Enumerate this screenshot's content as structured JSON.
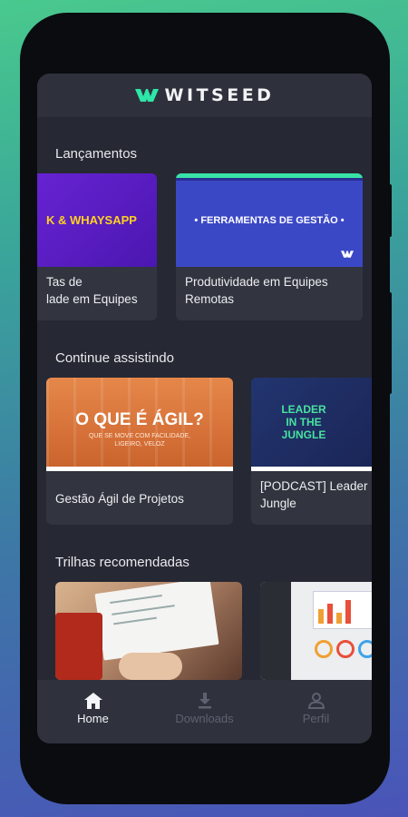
{
  "app": {
    "brand": "WITSEED",
    "brand_color": "#2ee6a8"
  },
  "sections": [
    {
      "title": "Lançamentos",
      "cards": [
        {
          "title": "Tas de\nlade em Equipes",
          "thumb_text": "K & WHAYSAPP",
          "thumb_color": "#5a1fc9"
        },
        {
          "title": "Produtividade em Equipes Remotas",
          "thumb_text": "• FERRAMENTAS DE GESTÃO •",
          "thumb_color": "#3a47c4"
        }
      ]
    },
    {
      "title": "Continue assistindo",
      "cards": [
        {
          "title": "Gestão Ágil de Projetos",
          "thumb_text": "O QUE É ÁGIL?",
          "thumb_subtext": "QUE SE MOVE COM FACILIDADE, LIGEIRO, VELOZ",
          "thumb_color": "#d9753a"
        },
        {
          "title": "[PODCAST] Leader Jungle",
          "thumb_text": "LEADER IN THE JUNGLE",
          "thumb_color": "#1d2e6b"
        }
      ]
    },
    {
      "title": "Trilhas recomendadas",
      "cards": [
        {
          "title": "",
          "thumb_color": "#c7a27e"
        },
        {
          "title": "",
          "thumb_color": "#e9eaee"
        }
      ]
    }
  ],
  "tabs": [
    {
      "label": "Home",
      "icon": "home-icon",
      "active": true
    },
    {
      "label": "Downloads",
      "icon": "download-icon",
      "active": false
    },
    {
      "label": "Perfil",
      "icon": "person-icon",
      "active": false
    }
  ]
}
